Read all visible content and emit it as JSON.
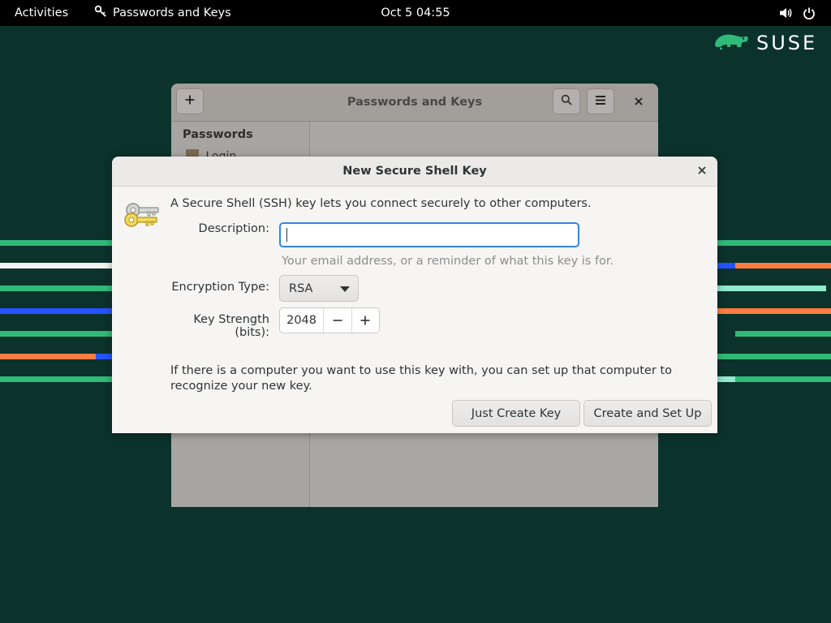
{
  "topbar": {
    "activities": "Activities",
    "app_name": "Passwords and Keys",
    "clock": "Oct 5  04:55"
  },
  "desktop": {
    "logo_text": "SUSE",
    "colors": {
      "background": "#0c322c",
      "brand_green": "#30ba78"
    }
  },
  "background_window": {
    "title": "Passwords and Keys",
    "sidebar_heading": "Passwords",
    "sidebar_item_partial": "Login"
  },
  "dialog": {
    "title": "New Secure Shell Key",
    "intro": "A Secure Shell (SSH) key lets you connect securely to other computers.",
    "description_label": "Description:",
    "description_value": "",
    "description_hint": "Your email address, or a reminder of what this key is for.",
    "encryption_label": "Encryption Type:",
    "encryption_value": "RSA",
    "strength_label": "Key Strength (bits):",
    "strength_value": "2048",
    "setup_text": "If there is a computer you want to use this key with, you can set up that computer to recognize your new key.",
    "just_create_label": "Just Create Key",
    "create_setup_label": "Create and Set Up",
    "colors": {
      "focus": "#3584e4"
    }
  }
}
